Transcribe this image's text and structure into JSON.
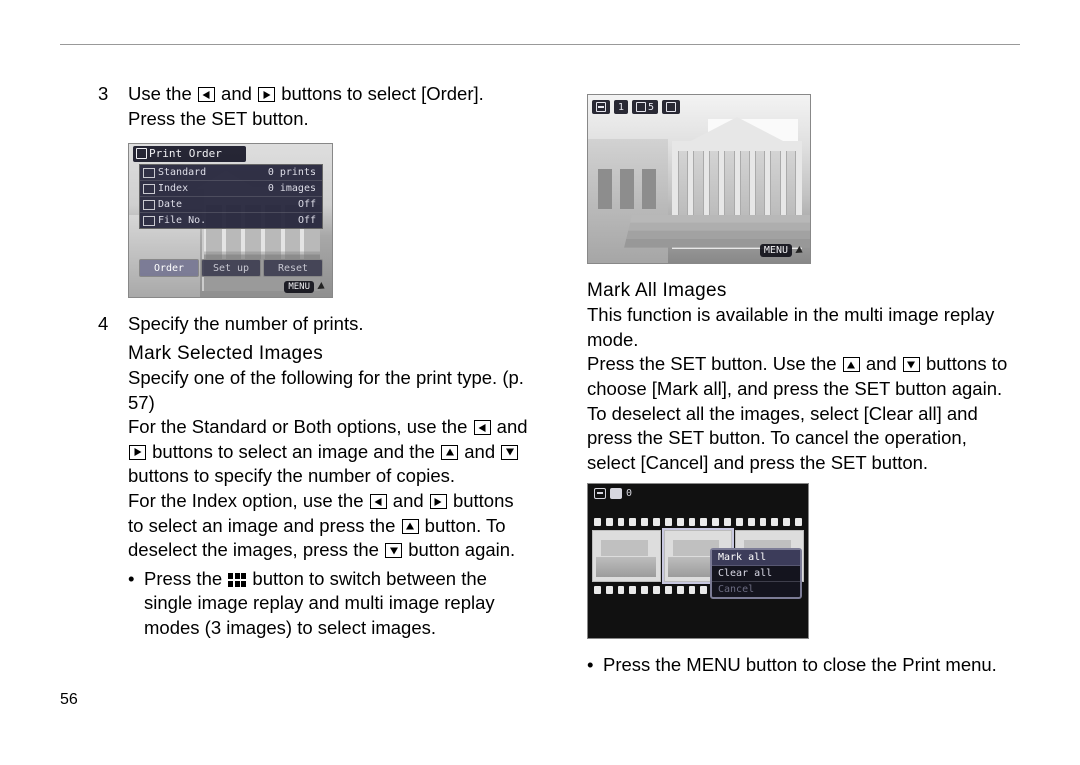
{
  "page_number": "56",
  "left": {
    "step3_num": "3",
    "step3_text_a": "Use the ",
    "step3_text_b": " and ",
    "step3_text_c": " buttons to select [Order]. Press the SET button.",
    "lcd1": {
      "title": "Print Order",
      "rows": [
        {
          "label": "Standard",
          "value": "0 prints"
        },
        {
          "label": "Index",
          "value": "0 images"
        },
        {
          "label": "Date",
          "value": "Off"
        },
        {
          "label": "File No.",
          "value": "Off"
        }
      ],
      "tabs": [
        "Order",
        "Set up",
        "Reset"
      ],
      "menu_label": "MENU"
    },
    "step4_num": "4",
    "step4_text": "Specify the number of prints.",
    "heading_mark_selected": "Mark Selected Images",
    "para1": "Specify one of the following for the print type. (p. 57)",
    "para2a": "For the Standard or Both options, use the ",
    "para2b": " and ",
    "para2c": " buttons to select an image and the ",
    "para2d": " and ",
    "para2e": " buttons to specify the number of copies.",
    "para3a": "For the Index option, use the ",
    "para3b": " and ",
    "para3c": " buttons to select an image and press the ",
    "para3d": " button. To deselect the images, press the ",
    "para3e": " button again.",
    "bullet1a": "Press the ",
    "bullet1b": " button to switch between the single image replay and multi image replay modes (3 images) to select images."
  },
  "right": {
    "lcd2": {
      "hud_num": "1",
      "hud_copies": "5",
      "menu_label": "MENU"
    },
    "heading_mark_all": "Mark All Images",
    "para1": "This function is available in the multi image replay mode.",
    "para2a": "Press the SET button. Use the ",
    "para2b": " and ",
    "para2c": " buttons to choose [Mark all], and press the SET button again.",
    "para3": "To deselect all the images, select [Clear all] and press the SET button. To cancel the operation, select [Cancel] and press the SET button.",
    "lcd3": {
      "count_label": "0",
      "menu_items": [
        "Mark all",
        "Clear all",
        "Cancel"
      ]
    },
    "bullet1": "Press the MENU button to close the Print menu."
  }
}
